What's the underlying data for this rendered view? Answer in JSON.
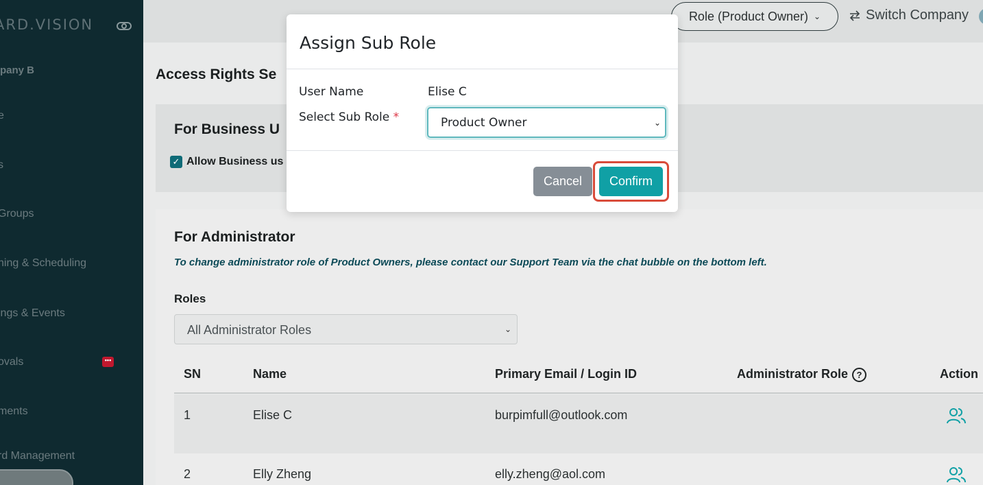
{
  "sidebar": {
    "brand": "ARD.VISION",
    "company": "pany B",
    "items": [
      {
        "label": "e"
      },
      {
        "label": "s"
      },
      {
        "label": "Groups"
      },
      {
        "label": "ning & Scheduling"
      },
      {
        "label": "ings & Events"
      },
      {
        "label": "ovals"
      },
      {
        "label": "ments"
      },
      {
        "label": "rd Management"
      }
    ],
    "approvals_badge": "•••"
  },
  "topbar": {
    "role_label": "Role (Product Owner)",
    "switch_company_label": "Switch Company"
  },
  "page": {
    "title": "Access Rights Se",
    "business_heading": "For Business U",
    "allow_business_label": "Allow Business us",
    "admin_heading": "For Administrator",
    "admin_note": "To change administrator role of Product Owners, please contact our Support Team via the chat bubble on the bottom left.",
    "roles_label": "Roles",
    "roles_select_value": "All Administrator Roles"
  },
  "table": {
    "headers": {
      "sn": "SN",
      "name": "Name",
      "email": "Primary Email / Login ID",
      "admin_role": "Administrator Role",
      "action": "Action"
    },
    "rows": [
      {
        "sn": "1",
        "name": "Elise C",
        "email": "burpimfull@outlook.com",
        "admin_role": ""
      },
      {
        "sn": "2",
        "name": "Elly Zheng",
        "email": "elly.zheng@aol.com",
        "admin_role": ""
      }
    ]
  },
  "modal": {
    "title": "Assign Sub Role",
    "user_name_label": "User Name",
    "user_name_value": "Elise C",
    "sub_role_label": "Select Sub Role",
    "required_mark": "*",
    "sub_role_value": "Product Owner",
    "cancel_label": "Cancel",
    "confirm_label": "Confirm"
  },
  "colors": {
    "sidebar_bg": "#0f2a30",
    "confirm_bg": "#10a0a5",
    "cancel_bg": "#868e96",
    "highlight_ring": "#d94b3a",
    "note_text": "#0c4a57"
  }
}
